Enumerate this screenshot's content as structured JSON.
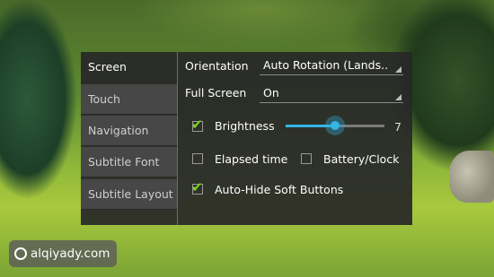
{
  "tabs": [
    {
      "label": "Screen"
    },
    {
      "label": "Touch"
    },
    {
      "label": "Navigation"
    },
    {
      "label": "Subtitle Font"
    },
    {
      "label": "Subtitle Layout"
    }
  ],
  "settings": {
    "orientation": {
      "label": "Orientation",
      "value": "Auto Rotation (Lands.."
    },
    "full_screen": {
      "label": "Full Screen",
      "value": "On"
    },
    "brightness": {
      "label": "Brightness",
      "checked": true,
      "value": "7",
      "level": 0.5
    },
    "elapsed_time": {
      "label": "Elapsed time",
      "checked": false
    },
    "battery_clock": {
      "label": "Battery/Clock",
      "checked": false
    },
    "auto_hide": {
      "label": "Auto-Hide Soft Buttons",
      "checked": true
    }
  },
  "watermark": {
    "text": "alqiyady.com"
  },
  "colors": {
    "accent": "#33b5e5",
    "check": "#7ed321"
  }
}
